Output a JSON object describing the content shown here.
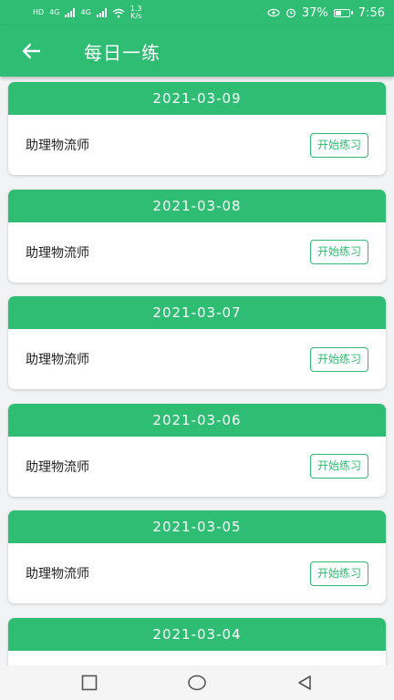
{
  "status_bar": {
    "network_left": "HD",
    "net_type_1": "4G",
    "net_type_2": "4G",
    "speed_value": "1.3",
    "speed_unit": "K/s",
    "battery_percent": "37%",
    "time": "7:56"
  },
  "app_bar": {
    "title": "每日一练"
  },
  "items": [
    {
      "date": "2021-03-09",
      "name": "助理物流师",
      "button": "开始练习"
    },
    {
      "date": "2021-03-08",
      "name": "助理物流师",
      "button": "开始练习"
    },
    {
      "date": "2021-03-07",
      "name": "助理物流师",
      "button": "开始练习"
    },
    {
      "date": "2021-03-06",
      "name": "助理物流师",
      "button": "开始练习"
    },
    {
      "date": "2021-03-05",
      "name": "助理物流师",
      "button": "开始练习"
    },
    {
      "date": "2021-03-04",
      "name": "",
      "button": ""
    }
  ],
  "colors": {
    "primary": "#2ebd73",
    "background": "#f2f3f5",
    "card": "#ffffff",
    "text": "#222222"
  },
  "icons": {
    "back": "arrow-left-icon",
    "nav_recent": "square-icon",
    "nav_home": "circle-icon",
    "nav_back": "triangle-icon"
  }
}
